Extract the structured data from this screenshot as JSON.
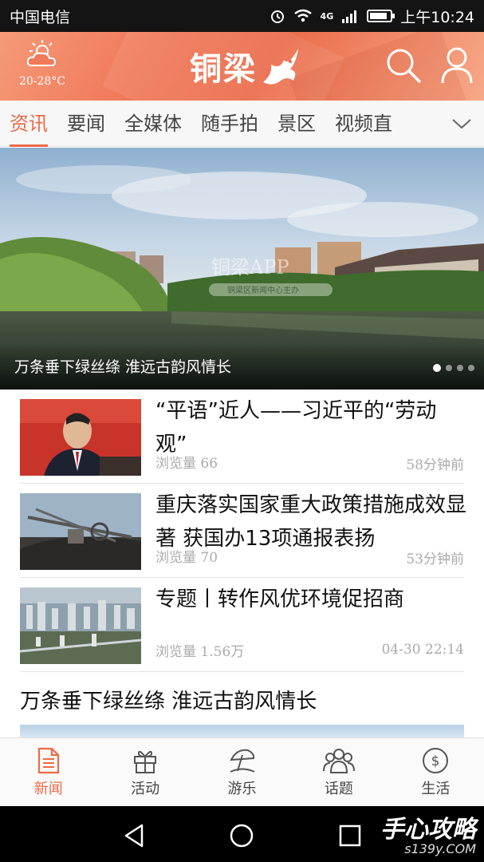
{
  "status_bar": {
    "carrier": "中国电信",
    "network": "4G",
    "time": "上午10:24",
    "battery_level": 0.85
  },
  "header": {
    "temperature": "20-28°C",
    "logo_text": "铜梁",
    "icons": [
      "weather-cloud-sun-icon",
      "search-icon",
      "user-icon"
    ]
  },
  "tabs": {
    "items": [
      "资讯",
      "要闻",
      "全媒体",
      "随手拍",
      "景区",
      "视频直"
    ],
    "active_index": 0
  },
  "banner": {
    "caption": "万条垂下绿丝绦 淮远古韵风情长",
    "watermark_line1": "铜梁APP",
    "watermark_line2": "铜梁区新闻中心主办",
    "slide_count": 4,
    "active_slide": 0
  },
  "news": [
    {
      "title": "“平语”近人——习近平的“劳动观”",
      "views_label": "浏览量",
      "views": "66",
      "time": "58分钟前"
    },
    {
      "title": "重庆落实国家重大政策措施成效显著  获国办13项通报表扬",
      "views_label": "浏览量",
      "views": "70",
      "time": "53分钟前"
    },
    {
      "title": "专题丨转作风优环境促招商",
      "views_label": "浏览量",
      "views": "1.56万",
      "time": "04-30 22:14"
    }
  ],
  "section_title": "万条垂下绿丝绦 淮远古韵风情长",
  "bottom_nav": {
    "items": [
      {
        "label": "新闻",
        "icon": "news-doc-icon"
      },
      {
        "label": "活动",
        "icon": "gift-icon"
      },
      {
        "label": "游乐",
        "icon": "beach-umbrella-icon"
      },
      {
        "label": "话题",
        "icon": "people-group-icon"
      },
      {
        "label": "生活",
        "icon": "dollar-circle-icon"
      }
    ],
    "active_index": 0
  },
  "watermark": {
    "main": "手心攻略",
    "sub": "s139y.COM"
  },
  "colors": {
    "accent": "#ec6a47",
    "header_gradient": "#f07a5a",
    "status_bar": "#141414"
  }
}
